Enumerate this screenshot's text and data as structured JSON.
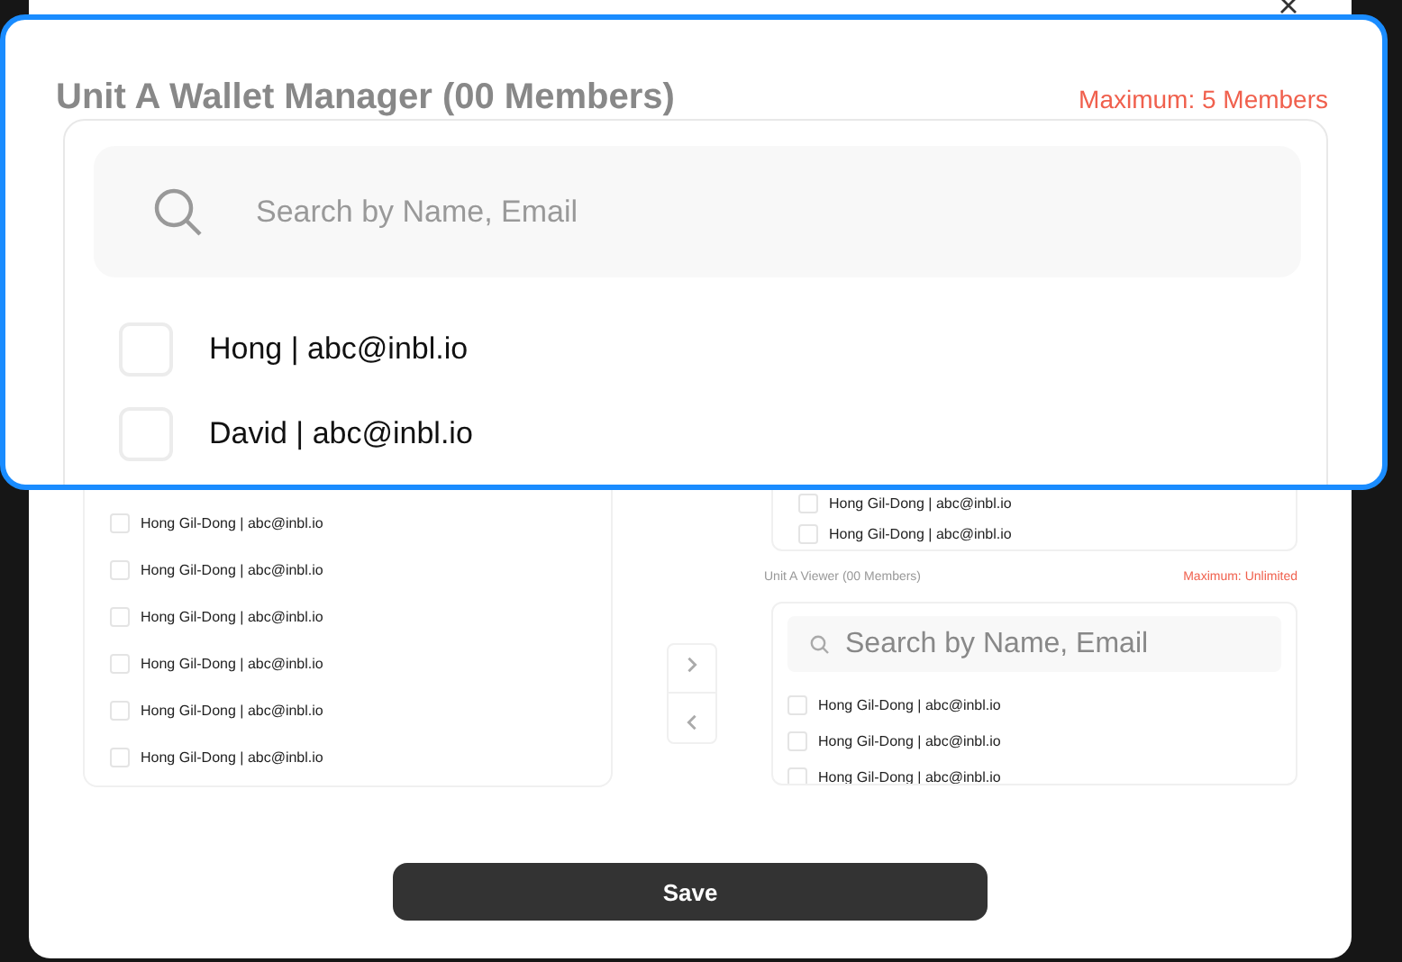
{
  "dialog": {
    "available_members": [
      {
        "label": "Hong Gil-Dong | abc@inbl.io",
        "checked": false
      },
      {
        "label": "Hong Gil-Dong | abc@inbl.io",
        "checked": false
      },
      {
        "label": "Hong Gil-Dong | abc@inbl.io",
        "checked": false
      },
      {
        "label": "Hong Gil-Dong | abc@inbl.io",
        "checked": false
      },
      {
        "label": "Hong Gil-Dong | abc@inbl.io",
        "checked": false
      },
      {
        "label": "Hong Gil-Dong | abc@inbl.io",
        "checked": false
      }
    ],
    "manager_members": [
      {
        "label": "Hong Gil-Dong | abc@inbl.io",
        "checked": false
      },
      {
        "label": "Hong Gil-Dong | abc@inbl.io",
        "checked": false
      }
    ],
    "viewer_panel": {
      "title": "Unit A Viewer (00 Members)",
      "limit": "Maximum: Unlimited",
      "search": {
        "placeholder": "Search by Name, Email"
      },
      "members": [
        {
          "label": "Hong Gil-Dong | abc@inbl.io",
          "checked": false
        },
        {
          "label": "Hong Gil-Dong | abc@inbl.io",
          "checked": false
        },
        {
          "label": "Hong Gil-Dong | abc@inbl.io",
          "checked": false
        }
      ]
    },
    "save_button": "Save"
  },
  "magnified_manager_panel": {
    "title": "Unit A Wallet Manager (00 Members)",
    "limit": "Maximum: 5 Members",
    "search": {
      "placeholder": "Search by Name, Email"
    },
    "members": [
      {
        "label": "Hong | abc@inbl.io",
        "checked": false
      },
      {
        "label": "David | abc@inbl.io",
        "checked": false
      }
    ]
  }
}
